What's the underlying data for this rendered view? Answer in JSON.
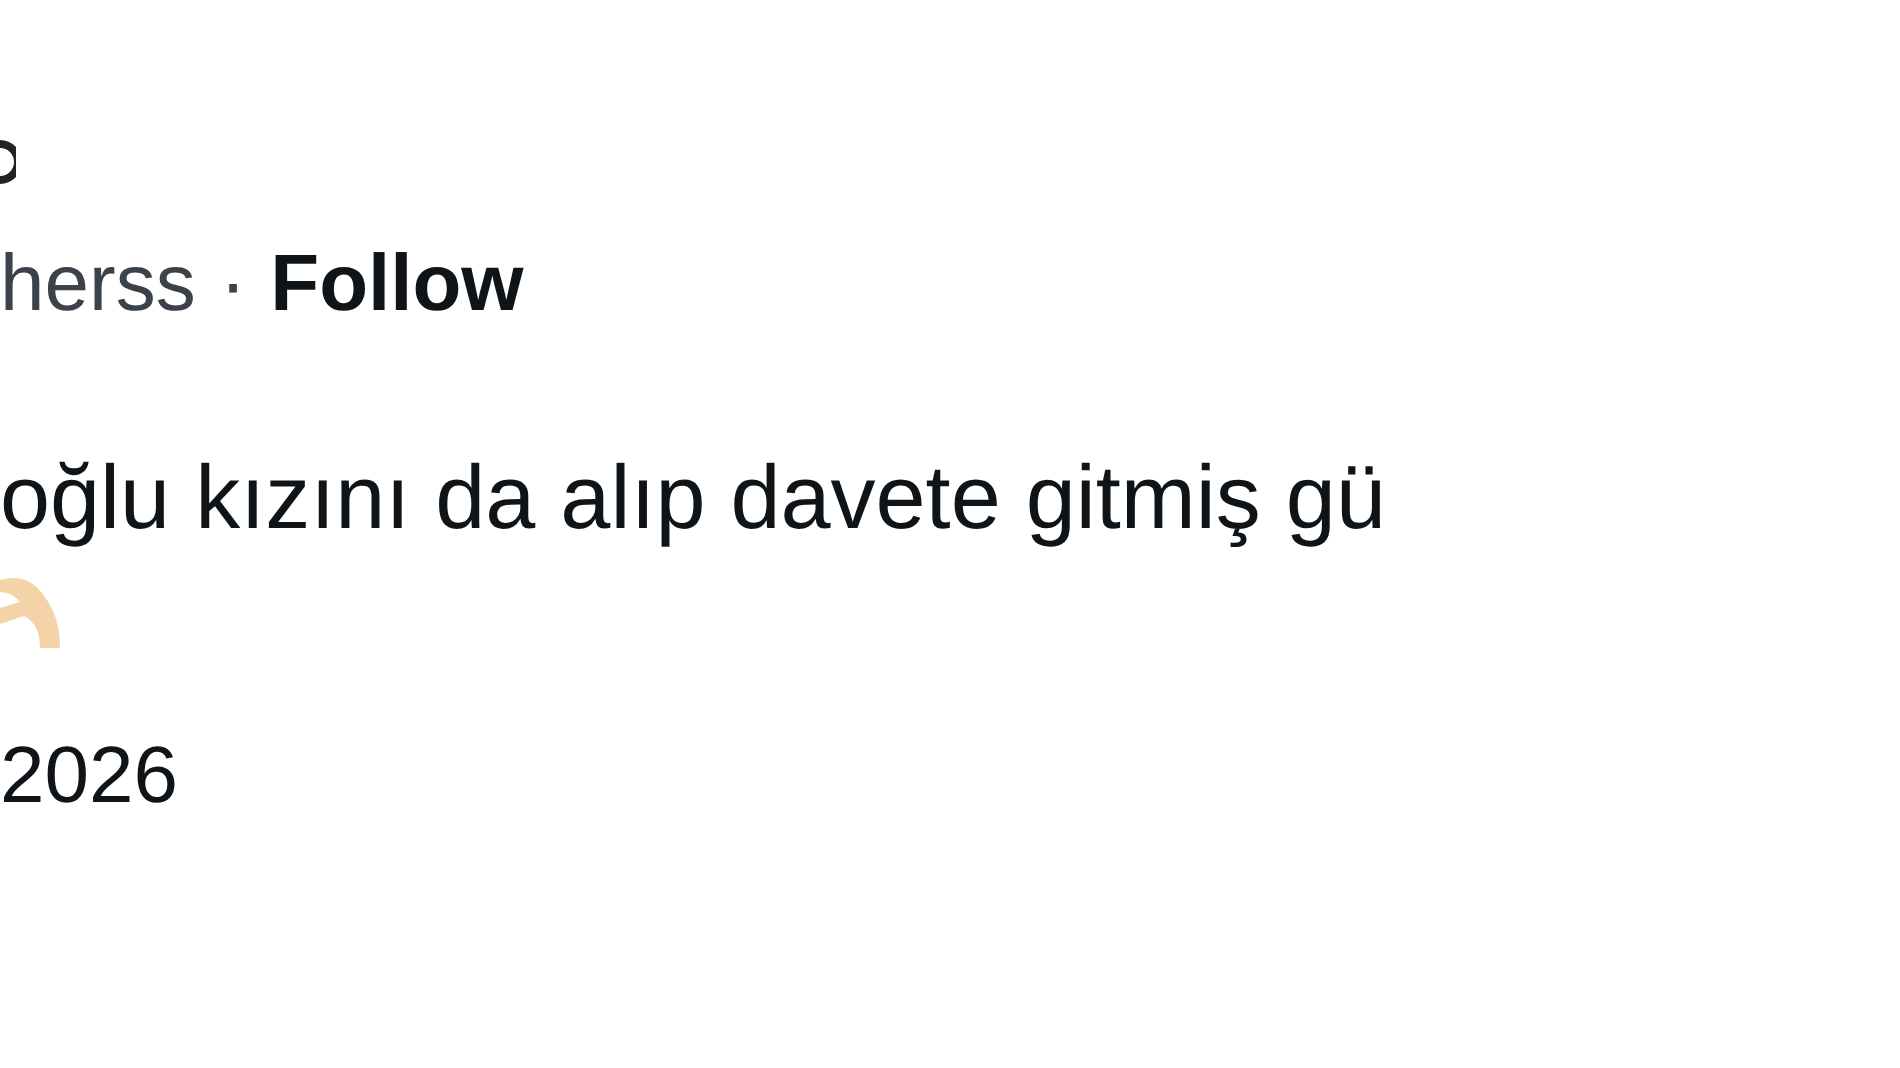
{
  "author": {
    "handle": "herss",
    "separator": "·",
    "follow": "Follow"
  },
  "tweet": {
    "text": "oğlu kızını da alıp davete gitmiş gü"
  },
  "date": "2026"
}
